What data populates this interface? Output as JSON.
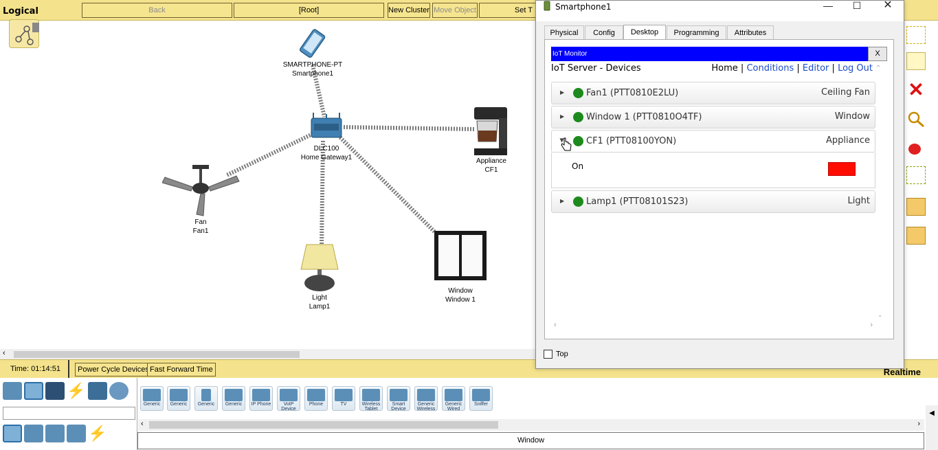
{
  "toolbar": {
    "mode_label": "Logical",
    "back_label": "Back",
    "root_label": "[Root]",
    "new_cluster_label": "New Cluster",
    "move_object_label": "Move Object",
    "set_label": "Set T"
  },
  "canvas": {
    "devices": [
      {
        "model": "SMARTPHONE-PT",
        "name": "Smartphone1"
      },
      {
        "model": "DLC100",
        "name": "Home Gateway1"
      },
      {
        "model": "Appliance",
        "name": "CF1"
      },
      {
        "model": "Fan",
        "name": "Fan1"
      },
      {
        "model": "Light",
        "name": "Lamp1"
      },
      {
        "model": "Window",
        "name": "Window 1"
      }
    ]
  },
  "status": {
    "time": "Time: 01:14:51",
    "power_cycle_label": "Power Cycle Devices",
    "fast_forward_label": "Fast Forward Time",
    "mode": "Realtime"
  },
  "palette": {
    "items": [
      "Generic",
      "Generic",
      "Generic",
      "Generic",
      "IP Phone",
      "VoIP Device",
      "Phone",
      "TV",
      "Wireless Tablet",
      "Smart Device",
      "Generic Wireless",
      "Generic Wired",
      "Sniffer"
    ],
    "selected_label": "Window"
  },
  "window": {
    "title": "Smartphone1",
    "tabs": [
      "Physical",
      "Config",
      "Desktop",
      "Programming",
      "Attributes"
    ],
    "active_tab": "Desktop",
    "top_checkbox_label": "Top"
  },
  "iot": {
    "title": "IoT Monitor",
    "close_label": "X",
    "header_left": "IoT Server - Devices",
    "nav": {
      "home": "Home",
      "sep": "|",
      "conditions": "Conditions",
      "editor": "Editor",
      "logout": "Log Out"
    },
    "devices": [
      {
        "name": "Fan1 (PTT0810E2LU)",
        "type": "Ceiling Fan"
      },
      {
        "name": "Window 1 (PTT0810O4TF)",
        "type": "Window"
      },
      {
        "name": "CF1 (PTT08100YON)",
        "type": "Appliance"
      },
      {
        "name": "Lamp1 (PTT08101S23)",
        "type": "Light"
      }
    ],
    "expanded": {
      "property": "On",
      "state_color": "#ff0d00"
    }
  },
  "colors": {
    "toolbar_bg": "#f4e38c",
    "iot_title_bg": "#0000ff",
    "status_dot": "#1c8a1c",
    "link": "#1b4cc7"
  }
}
